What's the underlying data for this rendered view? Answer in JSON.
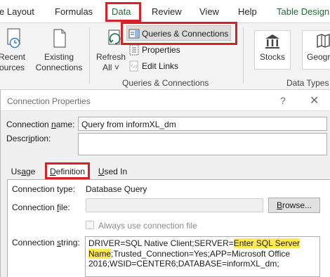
{
  "ribbon": {
    "tabs": [
      "e Layout",
      "Formulas",
      "Data",
      "Review",
      "View",
      "Help",
      "Table Design"
    ],
    "recent_sources_label": [
      "Recent",
      "ources"
    ],
    "existing_connections_label": [
      "Existing",
      "Connections"
    ],
    "refresh_all_label": [
      "Refresh",
      "All"
    ],
    "refresh_all_caret": "˅",
    "queries_connections": "Queries & Connections",
    "properties": "Properties",
    "edit_links": "Edit Links",
    "group_queries_label": "Queries & Connections",
    "stocks": "Stocks",
    "geography": "Geogr",
    "group_datatypes_label": "Data Types"
  },
  "dialog": {
    "title": "Connection Properties",
    "help_glyph": "?",
    "close_glyph": "✕",
    "connection_name_label": [
      "Connection ",
      "n",
      "ame:"
    ],
    "connection_name_value": "Query from informXL_dm",
    "description_label": [
      "Descr",
      "i",
      "ption:"
    ],
    "tabs": {
      "usage": [
        "Us",
        "a",
        "ge"
      ],
      "definition": [
        "",
        "D",
        "efinition"
      ],
      "used_in": [
        "",
        "U",
        "sed In"
      ]
    },
    "connection_type_label": "Connection type:",
    "connection_type_value": "Database Query",
    "connection_file_label": [
      "Connection ",
      "f",
      "ile:"
    ],
    "browse_label": [
      "",
      "B",
      "rowse..."
    ],
    "always_use_label": "Always use connection file",
    "connection_string_label": [
      "Connection ",
      "s",
      "tring:"
    ],
    "connection_string": {
      "part1": "DRIVER=SQL Native Client;SERVER=",
      "highlight": "Enter SQL Server Name",
      "part2": ";Trusted_Connection=Yes;APP=Microsoft Office 2016;WSID=CENTER6;DATABASE=informXL_dm;"
    }
  },
  "colors": {
    "accent_green": "#217346",
    "highlight_red": "#d3222a",
    "text_highlight_yellow": "#ffe94d"
  }
}
